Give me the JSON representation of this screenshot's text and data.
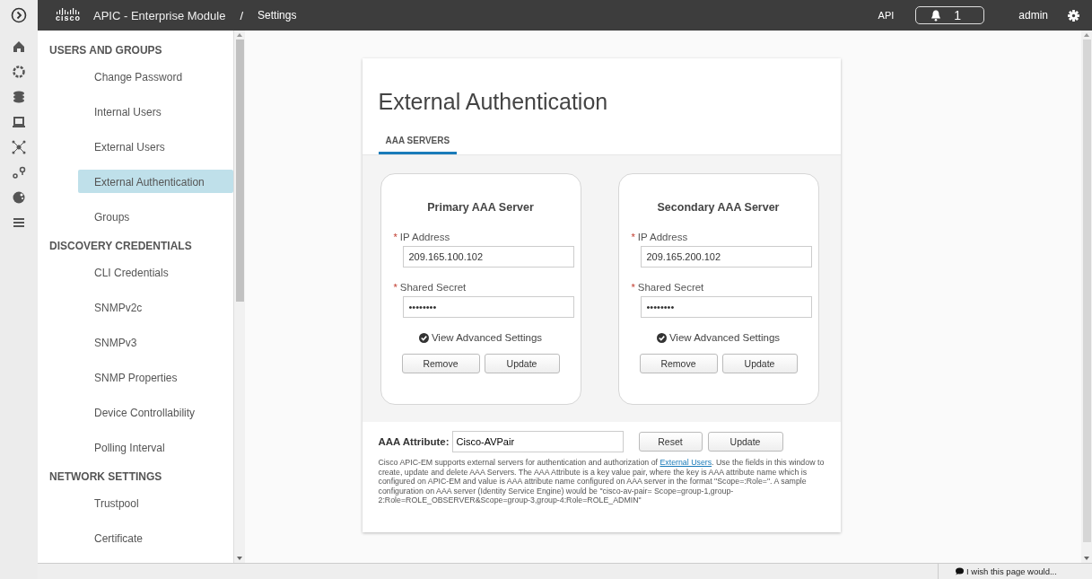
{
  "header": {
    "logo_text": "cisco",
    "app_title": "APIC - Enterprise Module",
    "separator": "/",
    "page": "Settings",
    "api": "API",
    "notifications": "1",
    "user": "admin"
  },
  "sidebar": {
    "sections": [
      {
        "title": "USERS AND GROUPS",
        "items": [
          {
            "label": "Change Password",
            "selected": false
          },
          {
            "label": "Internal Users",
            "selected": false
          },
          {
            "label": "External Users",
            "selected": false
          },
          {
            "label": "External Authentication",
            "selected": true
          },
          {
            "label": "Groups",
            "selected": false
          }
        ]
      },
      {
        "title": "DISCOVERY CREDENTIALS",
        "items": [
          {
            "label": "CLI Credentials",
            "selected": false
          },
          {
            "label": "SNMPv2c",
            "selected": false
          },
          {
            "label": "SNMPv3",
            "selected": false
          },
          {
            "label": "SNMP Properties",
            "selected": false
          },
          {
            "label": "Device Controllability",
            "selected": false
          },
          {
            "label": "Polling Interval",
            "selected": false
          }
        ]
      },
      {
        "title": "NETWORK SETTINGS",
        "items": [
          {
            "label": "Trustpool",
            "selected": false
          },
          {
            "label": "Certificate",
            "selected": false
          }
        ]
      }
    ]
  },
  "panel": {
    "title": "External Authentication",
    "tabs": [
      {
        "label": "AAA SERVERS",
        "selected": true
      }
    ],
    "servers": [
      {
        "title": "Primary AAA Server",
        "ip_label": "IP Address",
        "ip_value": "209.165.100.102",
        "secret_label": "Shared Secret",
        "secret_value": "••••••••",
        "advanced": "View Advanced Settings",
        "buttons": [
          "Remove",
          "Update"
        ]
      },
      {
        "title": "Secondary AAA Server",
        "ip_label": "IP Address",
        "ip_value": "209.165.200.102",
        "secret_label": "Shared Secret",
        "secret_value": "••••••••",
        "advanced": "View Advanced Settings",
        "buttons": [
          "Remove",
          "Update"
        ]
      }
    ],
    "required_mark": "*",
    "attribute": {
      "label": "AAA Attribute:",
      "value": "Cisco-AVPair",
      "buttons": [
        "Reset",
        "Update"
      ]
    },
    "help": {
      "before": "Cisco APIC-EM supports external servers for authentication and authorization of ",
      "link": "External Users",
      "after": ". Use the fields in this window to create, update and delete AAA Servers. The AAA Attribute is a key value pair, where the key is AAA attribute name which is configured on APIC-EM and value is AAA attribute name configured on AAA server in the format \"Scope=:Role=\". A sample configuration on AAA server (Identity Service Engine) would be \"cisco-av-pair= Scope=group-1,group-2:Role=ROLE_OBSERVER&Scope=group-3,group-4:Role=ROLE_ADMIN\""
    }
  },
  "status_bar": {
    "feedback": "I wish this page would..."
  }
}
